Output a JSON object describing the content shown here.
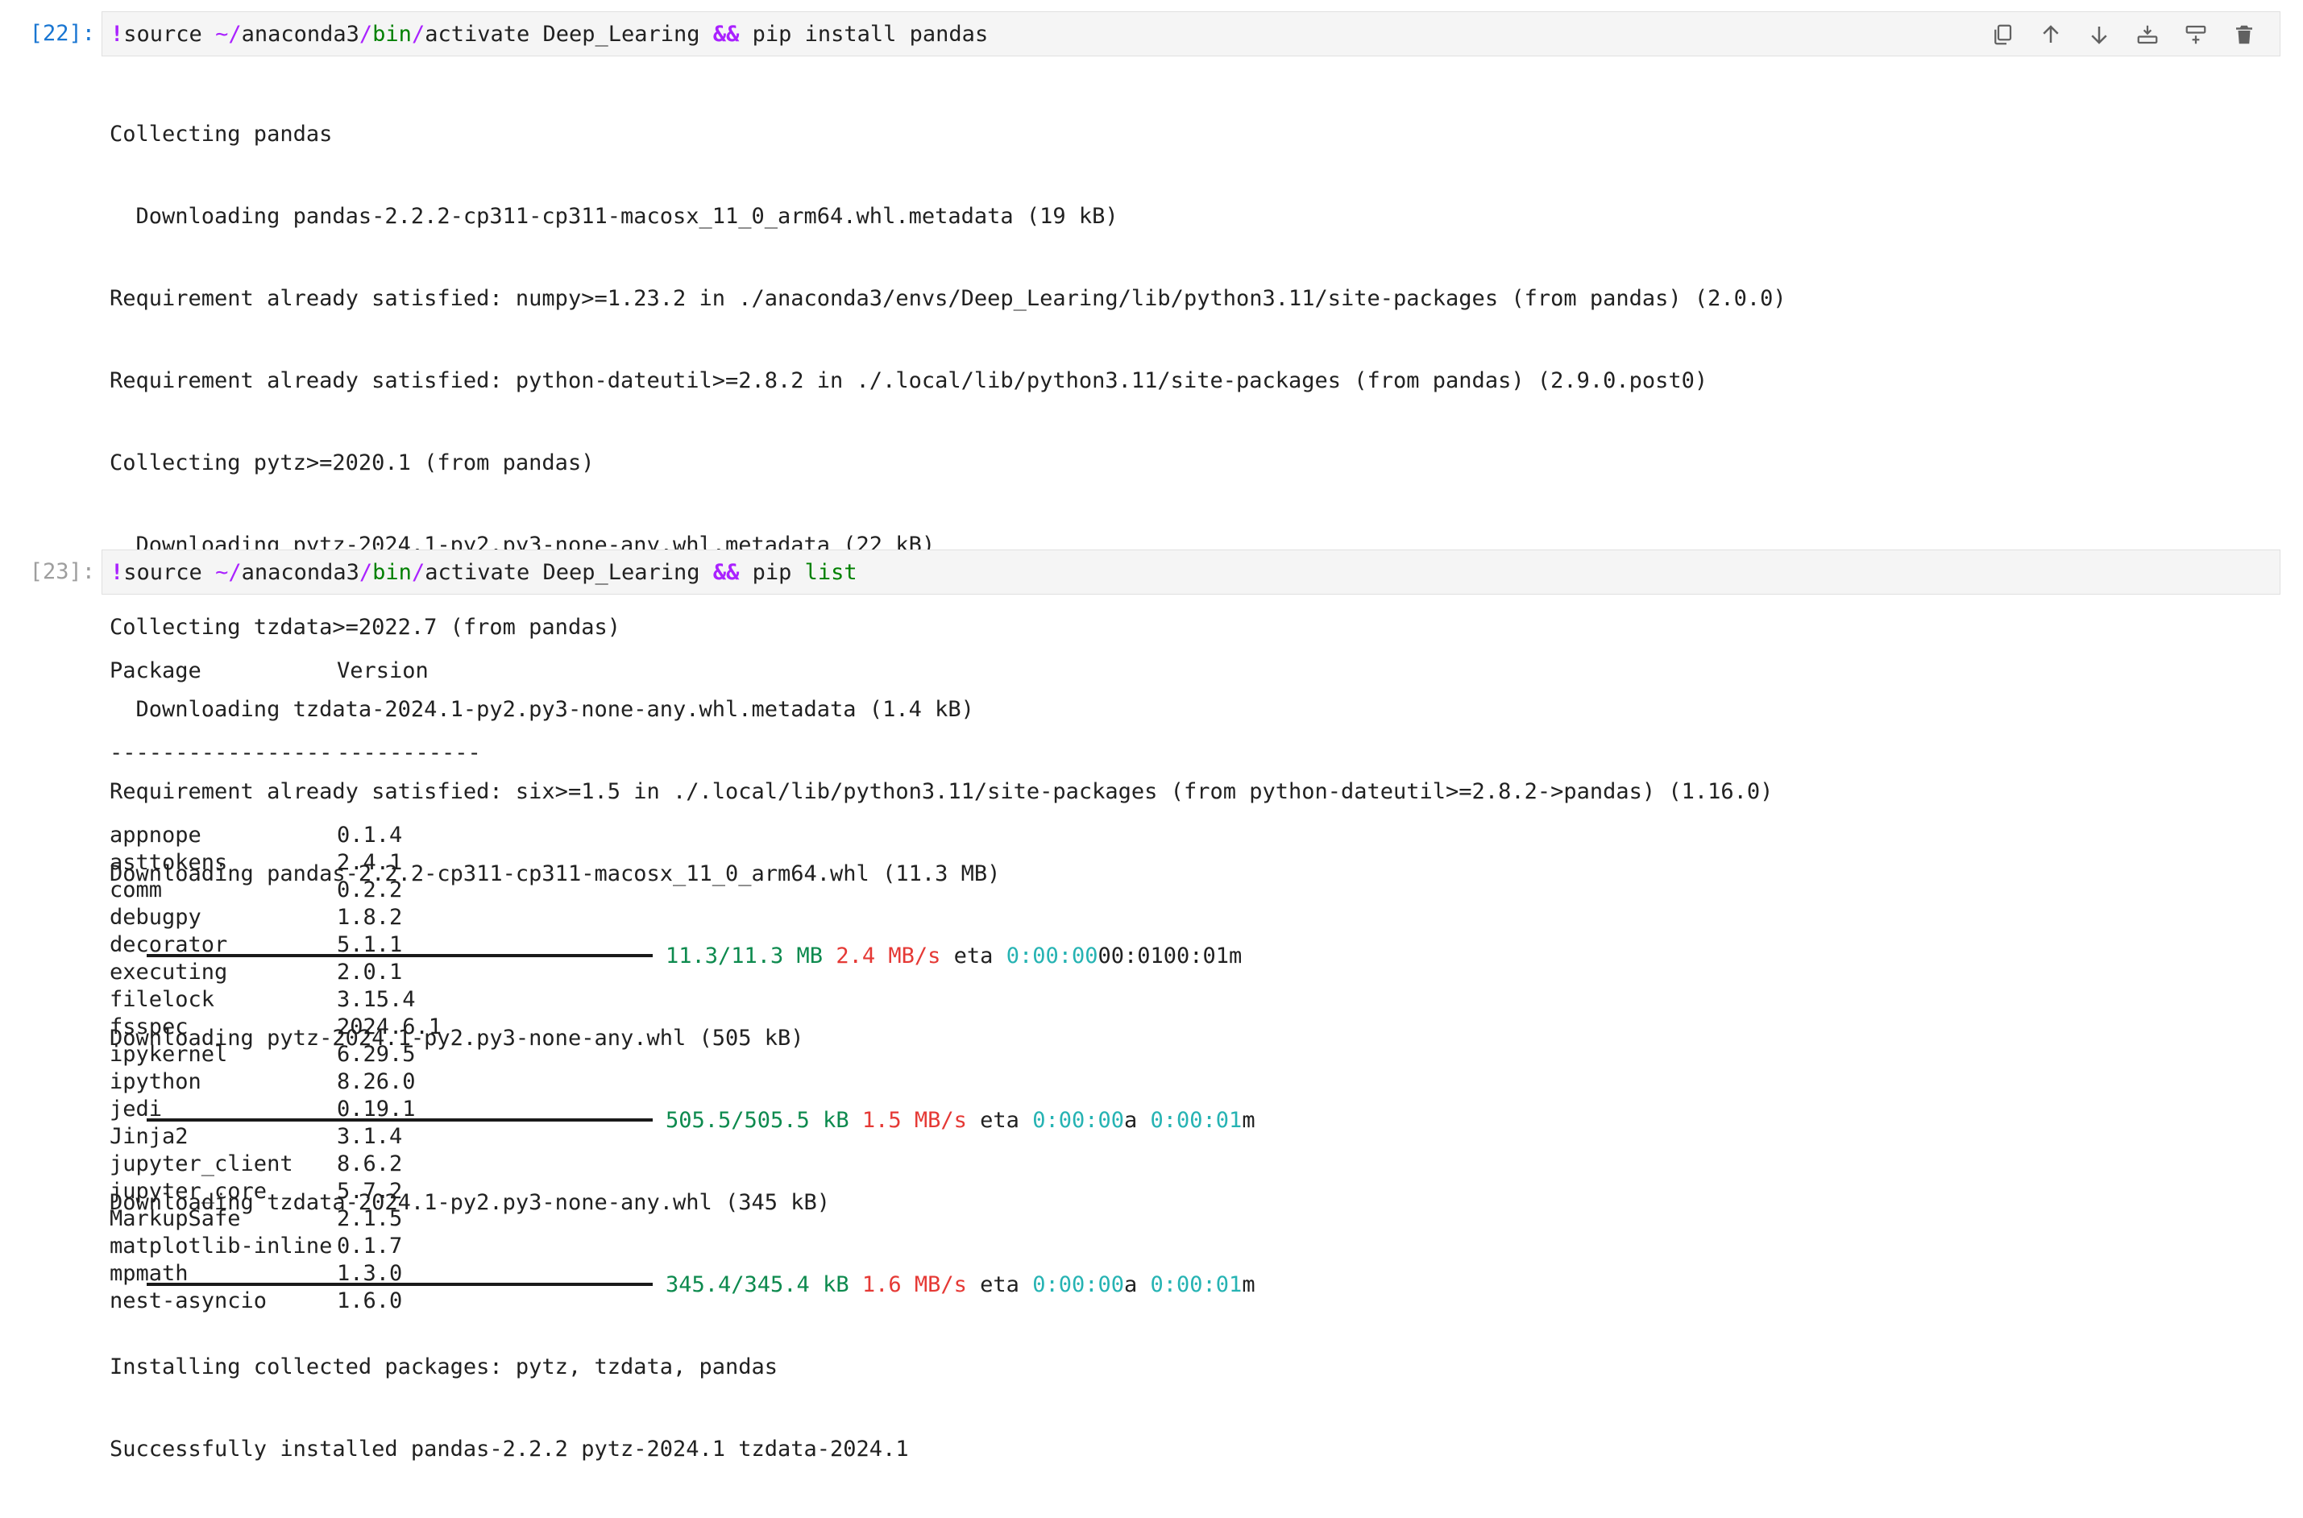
{
  "cells": [
    {
      "prompt": "[22]:",
      "command": {
        "bang": "!",
        "cmd1": "source ",
        "tilde": "~/",
        "dir1": "anaconda3",
        "slash1": "/",
        "dir2": "bin",
        "slash2": "/",
        "rest": "activate Deep_Learing ",
        "andand": "&&",
        "tail": " pip install pandas"
      },
      "toolbar": [
        "copy-icon",
        "arrow-up-icon",
        "arrow-down-icon",
        "insert-above-icon",
        "insert-below-icon",
        "trash-icon"
      ],
      "output": {
        "l1": "Collecting pandas",
        "l2": "  Downloading pandas-2.2.2-cp311-cp311-macosx_11_0_arm64.whl.metadata (19 kB)",
        "l3": "Requirement already satisfied: numpy>=1.23.2 in ./anaconda3/envs/Deep_Learing/lib/python3.11/site-packages (from pandas) (2.0.0)",
        "l4": "Requirement already satisfied: python-dateutil>=2.8.2 in ./.local/lib/python3.11/site-packages (from pandas) (2.9.0.post0)",
        "l5": "Collecting pytz>=2020.1 (from pandas)",
        "l6": "  Downloading pytz-2024.1-py2.py3-none-any.whl.metadata (22 kB)",
        "l7": "Collecting tzdata>=2022.7 (from pandas)",
        "l8": "  Downloading tzdata-2024.1-py2.py3-none-any.whl.metadata (1.4 kB)",
        "l9": "Requirement already satisfied: six>=1.5 in ./.local/lib/python3.11/site-packages (from python-dateutil>=2.8.2->pandas) (1.16.0)",
        "l10": "Downloading pandas-2.2.2-cp311-cp311-macosx_11_0_arm64.whl (11.3 MB)",
        "p1": {
          "size": "11.3/11.3 MB",
          "speed": "2.4 MB/s",
          "eta": "eta",
          "t1": "0:00:00",
          "tail": "00:0100:01m"
        },
        "l11": "Downloading pytz-2024.1-py2.py3-none-any.whl (505 kB)",
        "p2": {
          "size": "505.5/505.5 kB",
          "speed": "1.5 MB/s",
          "eta": "eta",
          "t1": "0:00:00",
          "mid": "a ",
          "t2": "0:00:01",
          "tail": "m"
        },
        "l12": "Downloading tzdata-2024.1-py2.py3-none-any.whl (345 kB)",
        "p3": {
          "size": "345.4/345.4 kB",
          "speed": "1.6 MB/s",
          "eta": "eta",
          "t1": "0:00:00",
          "mid": "a ",
          "t2": "0:00:01",
          "tail": "m"
        },
        "l13": "Installing collected packages: pytz, tzdata, pandas",
        "l14": "Successfully installed pandas-2.2.2 pytz-2024.1 tzdata-2024.1"
      }
    },
    {
      "prompt": "[23]:",
      "command": {
        "bang": "!",
        "cmd1": "source ",
        "tilde": "~/",
        "dir1": "anaconda3",
        "slash1": "/",
        "dir2": "bin",
        "slash2": "/",
        "rest": "activate Deep_Learing ",
        "andand": "&&",
        "tail": " pip ",
        "list": "list"
      },
      "output": {
        "header_pkg": "Package",
        "header_ver": "Version",
        "sep_pkg": "-----------------",
        "sep_ver": "-----------",
        "rows": [
          {
            "pkg": "appnope",
            "ver": "0.1.4"
          },
          {
            "pkg": "asttokens",
            "ver": "2.4.1"
          },
          {
            "pkg": "comm",
            "ver": "0.2.2"
          },
          {
            "pkg": "debugpy",
            "ver": "1.8.2"
          },
          {
            "pkg": "decorator",
            "ver": "5.1.1"
          },
          {
            "pkg": "executing",
            "ver": "2.0.1"
          },
          {
            "pkg": "filelock",
            "ver": "3.15.4"
          },
          {
            "pkg": "fsspec",
            "ver": "2024.6.1"
          },
          {
            "pkg": "ipykernel",
            "ver": "6.29.5"
          },
          {
            "pkg": "ipython",
            "ver": "8.26.0"
          },
          {
            "pkg": "jedi",
            "ver": "0.19.1"
          },
          {
            "pkg": "Jinja2",
            "ver": "3.1.4"
          },
          {
            "pkg": "jupyter_client",
            "ver": "8.6.2"
          },
          {
            "pkg": "jupyter_core",
            "ver": "5.7.2"
          },
          {
            "pkg": "MarkupSafe",
            "ver": "2.1.5"
          },
          {
            "pkg": "matplotlib-inline",
            "ver": "0.1.7"
          },
          {
            "pkg": "mpmath",
            "ver": "1.3.0"
          },
          {
            "pkg": "nest-asyncio",
            "ver": "1.6.0"
          }
        ]
      }
    }
  ],
  "colors": {
    "prompt_active": "#1976d2",
    "prompt_idle": "#9e9e9e",
    "progress_green": "#0d8a4e",
    "progress_red": "#e53935",
    "progress_cyan": "#26b3b3",
    "keyword_purple": "#aa22ff"
  }
}
